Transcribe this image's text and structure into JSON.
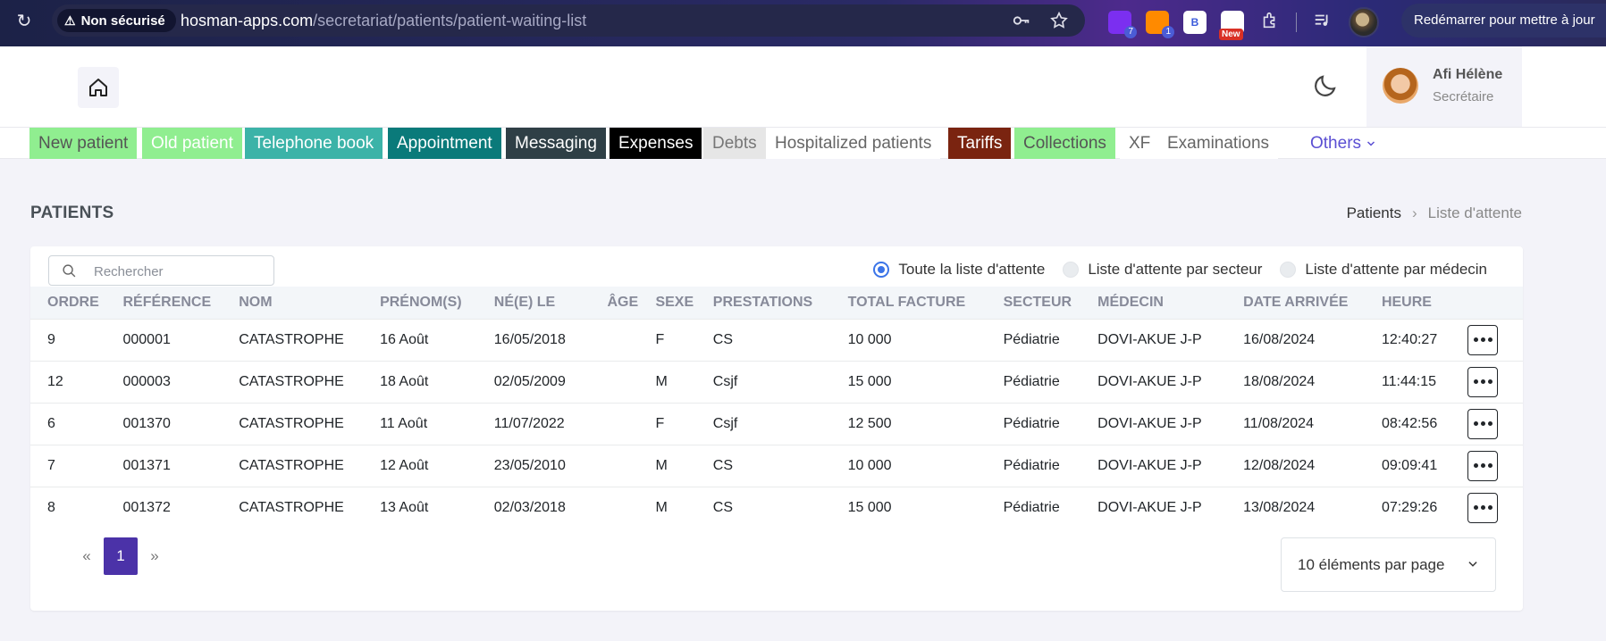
{
  "browser": {
    "security_label": "Non sécurisé",
    "url_host": "hosman-apps.com",
    "url_path": "/secretariat/patients/patient-waiting-list",
    "ext_badge_1": "7",
    "ext_badge_2": "1",
    "ext_letter": "B",
    "ext_new": "New",
    "restart_label": "Redémarrer pour mettre à jour"
  },
  "user": {
    "name": "Afi Hélène",
    "role": "Secrétaire"
  },
  "nav": [
    {
      "label": "New patient",
      "bg": "#90ee90",
      "color": "#555555"
    },
    {
      "label": "Old patient",
      "bg": "#90ee90",
      "color": "#ffffff"
    },
    {
      "label": "Telephone book",
      "bg": "#3cb3a8",
      "color": "#ffffff"
    },
    {
      "label": "Appointment",
      "bg": "#0a7a7a",
      "color": "#ffffff"
    },
    {
      "label": "Messaging",
      "bg": "#2f3f46",
      "color": "#ffffff"
    },
    {
      "label": "Expenses",
      "bg": "#000000",
      "color": "#ffffff"
    },
    {
      "label": "Debts",
      "bg": "#e6e6e6",
      "color": "#777777"
    },
    {
      "label": "Hospitalized patients",
      "bg": "#ffffff",
      "color": "#666666"
    },
    {
      "label": "Tariffs",
      "bg": "#7a2410",
      "color": "#ffffff"
    },
    {
      "label": "Collections",
      "bg": "#90ee90",
      "color": "#555555"
    },
    {
      "label": "XF",
      "bg": "#ffffff",
      "color": "#666666"
    },
    {
      "label": "Examinations",
      "bg": "#ffffff",
      "color": "#666666"
    }
  ],
  "nav_others": "Others",
  "page": {
    "title": "PATIENTS",
    "breadcrumb_home": "Patients",
    "breadcrumb_current": "Liste d'attente"
  },
  "search": {
    "placeholder": "Rechercher"
  },
  "filters": [
    {
      "label": "Toute la liste d'attente",
      "selected": true
    },
    {
      "label": "Liste d'attente par secteur",
      "selected": false
    },
    {
      "label": "Liste d'attente par médecin",
      "selected": false
    }
  ],
  "table": {
    "columns": [
      "ORDRE",
      "RÉFÉRENCE",
      "NOM",
      "PRÉNOM(S)",
      "NÉ(E) LE",
      "ÂGE",
      "SEXE",
      "PRESTATIONS",
      "TOTAL FACTURE",
      "SECTEUR",
      "MÉDECIN",
      "DATE ARRIVÉE",
      "HEURE",
      ""
    ],
    "rows": [
      [
        "9",
        "000001",
        "CATASTROPHE",
        "16 Août",
        "16/05/2018",
        "",
        "F",
        "CS",
        "10 000",
        "Pédiatrie",
        "DOVI-AKUE J-P",
        "16/08/2024",
        "12:40:27"
      ],
      [
        "12",
        "000003",
        "CATASTROPHE",
        "18 Août",
        "02/05/2009",
        "",
        "M",
        "Csjf",
        "15 000",
        "Pédiatrie",
        "DOVI-AKUE J-P",
        "18/08/2024",
        "11:44:15"
      ],
      [
        "6",
        "001370",
        "CATASTROPHE",
        "11 Août",
        "11/07/2022",
        "",
        "F",
        "Csjf",
        "12 500",
        "Pédiatrie",
        "DOVI-AKUE J-P",
        "11/08/2024",
        "08:42:56"
      ],
      [
        "7",
        "001371",
        "CATASTROPHE",
        "12 Août",
        "23/05/2010",
        "",
        "M",
        "CS",
        "10 000",
        "Pédiatrie",
        "DOVI-AKUE J-P",
        "12/08/2024",
        "09:09:41"
      ],
      [
        "8",
        "001372",
        "CATASTROPHE",
        "13 Août",
        "02/03/2018",
        "",
        "M",
        "CS",
        "15 000",
        "Pédiatrie",
        "DOVI-AKUE J-P",
        "13/08/2024",
        "07:29:26"
      ]
    ]
  },
  "pagination": {
    "prev": "«",
    "current": "1",
    "next": "»"
  },
  "per_page": "10 éléments par page"
}
